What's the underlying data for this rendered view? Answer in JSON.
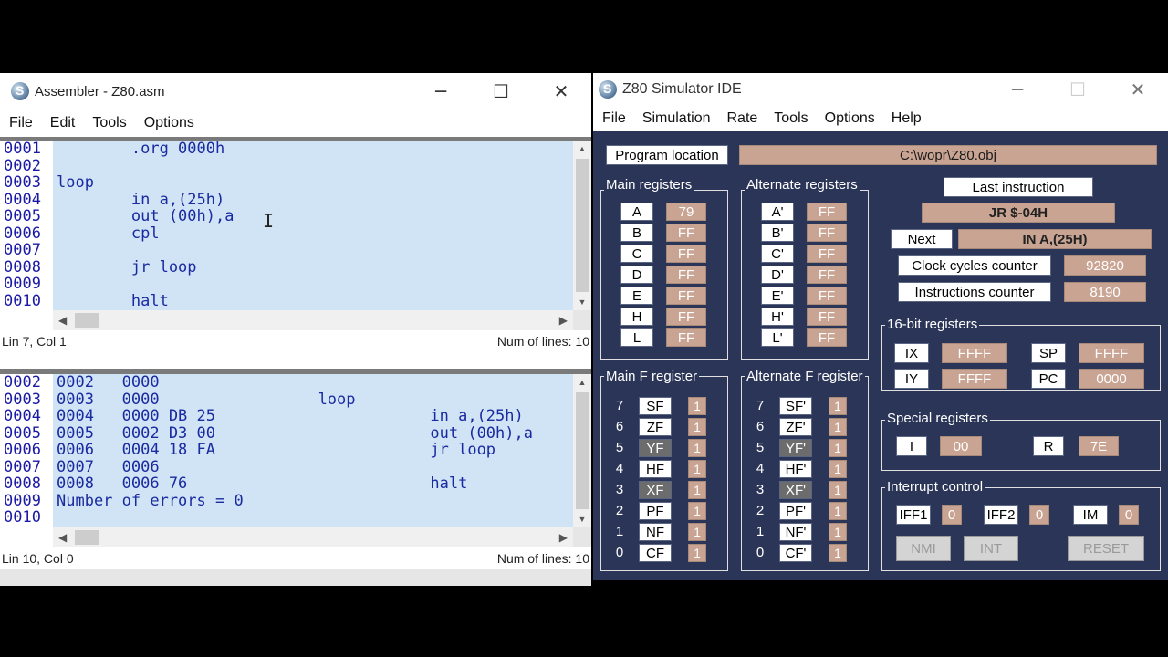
{
  "assembler": {
    "title": "Assembler - Z80.asm",
    "window_controls": {
      "minimize": "─",
      "maximize": "☐",
      "close": "✕"
    },
    "menu": [
      "File",
      "Edit",
      "Tools",
      "Options"
    ],
    "editor": {
      "lines": [
        {
          "num": "0001",
          "code": "        .org 0000h"
        },
        {
          "num": "0002",
          "code": ""
        },
        {
          "num": "0003",
          "code": "loop"
        },
        {
          "num": "0004",
          "code": "        in a,(25h)"
        },
        {
          "num": "0005",
          "code": "        out (00h),a"
        },
        {
          "num": "0006",
          "code": "        cpl"
        },
        {
          "num": "0007",
          "code": ""
        },
        {
          "num": "0008",
          "code": "        jr loop"
        },
        {
          "num": "0009",
          "code": ""
        },
        {
          "num": "0010",
          "code": "        halt"
        }
      ],
      "status_left": "Lin 7, Col 1",
      "status_right": "Num of lines: 10"
    },
    "listing": {
      "lines": [
        {
          "num": "0002",
          "code": "0002   0000"
        },
        {
          "num": "0003",
          "code": "0003   0000                 loop"
        },
        {
          "num": "0004",
          "code": "0004   0000 DB 25                       in a,(25h)"
        },
        {
          "num": "0005",
          "code": "0005   0002 D3 00                       out (00h),a"
        },
        {
          "num": "0006",
          "code": "0006   0004 18 FA                       jr loop"
        },
        {
          "num": "0007",
          "code": "0007   0006"
        },
        {
          "num": "0008",
          "code": "0008   0006 76                          halt"
        },
        {
          "num": "0009",
          "code": "Number of errors = 0"
        },
        {
          "num": "0010",
          "code": ""
        }
      ],
      "status_left": "Lin 10, Col 0",
      "status_right": "Num of lines: 10"
    }
  },
  "simulator": {
    "title": "Z80 Simulator IDE",
    "window_controls": {
      "minimize": "─",
      "maximize": "☐",
      "close": "✕"
    },
    "menu": [
      "File",
      "Simulation",
      "Rate",
      "Tools",
      "Options",
      "Help"
    ],
    "program_location_label": "Program location",
    "program_location_value": "C:\\wopr\\Z80.obj",
    "main_registers_label": "Main registers",
    "main_registers": [
      {
        "name": "A",
        "value": "79"
      },
      {
        "name": "B",
        "value": "FF"
      },
      {
        "name": "C",
        "value": "FF"
      },
      {
        "name": "D",
        "value": "FF"
      },
      {
        "name": "E",
        "value": "FF"
      },
      {
        "name": "H",
        "value": "FF"
      },
      {
        "name": "L",
        "value": "FF"
      }
    ],
    "alternate_registers_label": "Alternate registers",
    "alternate_registers": [
      {
        "name": "A'",
        "value": "FF"
      },
      {
        "name": "B'",
        "value": "FF"
      },
      {
        "name": "C'",
        "value": "FF"
      },
      {
        "name": "D'",
        "value": "FF"
      },
      {
        "name": "E'",
        "value": "FF"
      },
      {
        "name": "H'",
        "value": "FF"
      },
      {
        "name": "L'",
        "value": "FF"
      }
    ],
    "last_instruction_label": "Last instruction",
    "last_instruction_value": "JR $-04H",
    "next_label": "Next",
    "next_value": "IN A,(25H)",
    "clock_cycles_label": "Clock cycles counter",
    "clock_cycles_value": "92820",
    "instructions_label": "Instructions counter",
    "instructions_value": "8190",
    "reg16_label": "16-bit registers",
    "reg16": [
      {
        "name": "IX",
        "value": "FFFF"
      },
      {
        "name": "SP",
        "value": "FFFF"
      },
      {
        "name": "IY",
        "value": "FFFF"
      },
      {
        "name": "PC",
        "value": "0000"
      }
    ],
    "main_f_label": "Main F register",
    "main_f": [
      {
        "bit": "7",
        "name": "SF",
        "value": "1",
        "dim": false
      },
      {
        "bit": "6",
        "name": "ZF",
        "value": "1",
        "dim": false
      },
      {
        "bit": "5",
        "name": "YF",
        "value": "1",
        "dim": true
      },
      {
        "bit": "4",
        "name": "HF",
        "value": "1",
        "dim": false
      },
      {
        "bit": "3",
        "name": "XF",
        "value": "1",
        "dim": true
      },
      {
        "bit": "2",
        "name": "PF",
        "value": "1",
        "dim": false
      },
      {
        "bit": "1",
        "name": "NF",
        "value": "1",
        "dim": false
      },
      {
        "bit": "0",
        "name": "CF",
        "value": "1",
        "dim": false
      }
    ],
    "alt_f_label": "Alternate F register",
    "alt_f": [
      {
        "bit": "7",
        "name": "SF'",
        "value": "1",
        "dim": false
      },
      {
        "bit": "6",
        "name": "ZF'",
        "value": "1",
        "dim": false
      },
      {
        "bit": "5",
        "name": "YF'",
        "value": "1",
        "dim": true
      },
      {
        "bit": "4",
        "name": "HF'",
        "value": "1",
        "dim": false
      },
      {
        "bit": "3",
        "name": "XF'",
        "value": "1",
        "dim": true
      },
      {
        "bit": "2",
        "name": "PF'",
        "value": "1",
        "dim": false
      },
      {
        "bit": "1",
        "name": "NF'",
        "value": "1",
        "dim": false
      },
      {
        "bit": "0",
        "name": "CF'",
        "value": "1",
        "dim": false
      }
    ],
    "special_label": "Special registers",
    "special": [
      {
        "name": "I",
        "value": "00"
      },
      {
        "name": "R",
        "value": "7E"
      }
    ],
    "interrupt_label": "Interrupt control",
    "interrupt": [
      {
        "name": "IFF1",
        "value": "0"
      },
      {
        "name": "IFF2",
        "value": "0"
      },
      {
        "name": "IM",
        "value": "0"
      }
    ],
    "buttons": {
      "nmi": "NMI",
      "int": "INT",
      "reset": "RESET"
    }
  }
}
